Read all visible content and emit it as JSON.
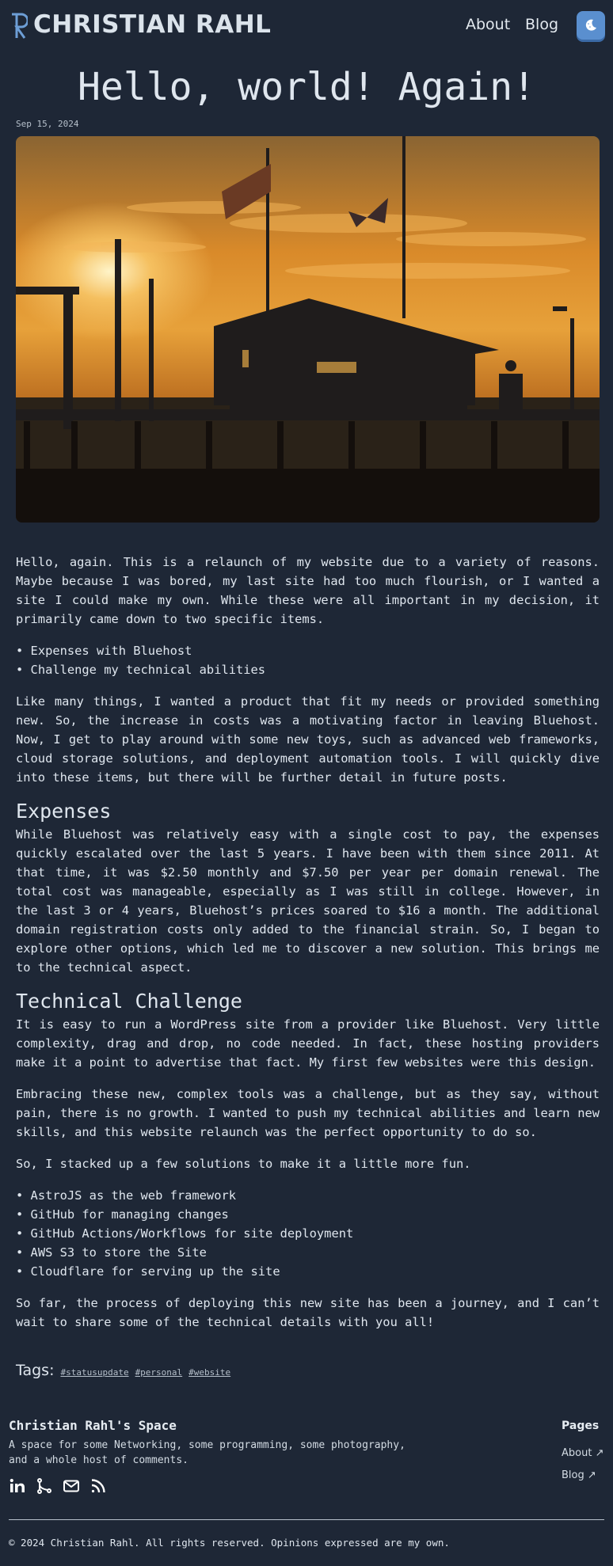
{
  "header": {
    "logo_text": "CHRISTIAN RAHL",
    "nav": [
      "About",
      "Blog"
    ],
    "theme_toggle_icon": "moon-icon"
  },
  "post": {
    "title": "Hello, world! Again!",
    "date": "Sep 15, 2024",
    "intro": "Hello, again. This is a relaunch of my website due to a variety of reasons. Maybe because I was bored, my last site had too much flourish, or I wanted a site I could make my own.  While these were all important in my decision, it primarily came down to two specific items.",
    "reasons": [
      "Expenses with Bluehost",
      "Challenge my technical abilities"
    ],
    "p2": "Like many things, I wanted a product that fit my needs or provided something new. So, the increase in costs was a motivating factor in leaving Bluehost. Now, I get to play around with some new toys, such as advanced web frameworks, cloud storage solutions, and deployment automation tools. I will quickly dive into these items, but there will be further detail in future posts.",
    "h_expenses": "Expenses",
    "p_expenses": "While Bluehost was relatively easy with a single cost to pay, the expenses quickly escalated over the last 5 years. I have been with them since 2011. At that time, it was $2.50 monthly and $7.50 per year per domain renewal. The total cost was manageable, especially as I was still in college. However, in the last 3 or 4 years, Bluehost’s prices soared to $16 a month. The additional domain registration costs only added to the financial strain. So, I began to explore other options, which led me to discover a new solution. This brings me to the technical aspect.",
    "h_technical": "Technical Challenge",
    "p_tech1": "It is easy to run a WordPress site from a provider like Bluehost. Very little complexity, drag and drop, no code needed. In fact, these hosting providers make it a point to advertise that fact. My first few websites were this design.",
    "p_tech2": "Embracing these new, complex tools was a challenge, but as they say, without pain, there is no growth. I wanted to push my technical abilities and learn new skills, and this website relaunch was the perfect opportunity to do so.",
    "p_tech3": "So, I stacked up a few solutions to make it a little more fun.",
    "stack": [
      "AstroJS as the web framework",
      "GitHub for managing changes",
      "GitHub Actions/Workflows for site deployment",
      "AWS S3 to store the Site",
      "Cloudflare for serving up the site"
    ],
    "p_final": "So far, the process of deploying this new site has been a journey, and I can’t wait to share some of the technical details with you all!"
  },
  "tags": {
    "label": "Tags:",
    "items": [
      "#statusupdate",
      "#personal",
      "#website"
    ]
  },
  "footer": {
    "title": "Christian Rahl's Space",
    "description": "A space for some Networking, some programming, some photography, and a whole host of comments.",
    "social_icons": [
      "linkedin-icon",
      "git-icon",
      "mail-icon",
      "rss-icon"
    ],
    "pages_title": "Pages",
    "pages": [
      "About ↗",
      "Blog ↗"
    ],
    "copyright": "© 2024 Christian Rahl. All rights reserved. Opinions expressed are my own."
  },
  "colors": {
    "background": "#1e2736",
    "text": "#dfe6ee",
    "accent": "#5a8fcf"
  }
}
